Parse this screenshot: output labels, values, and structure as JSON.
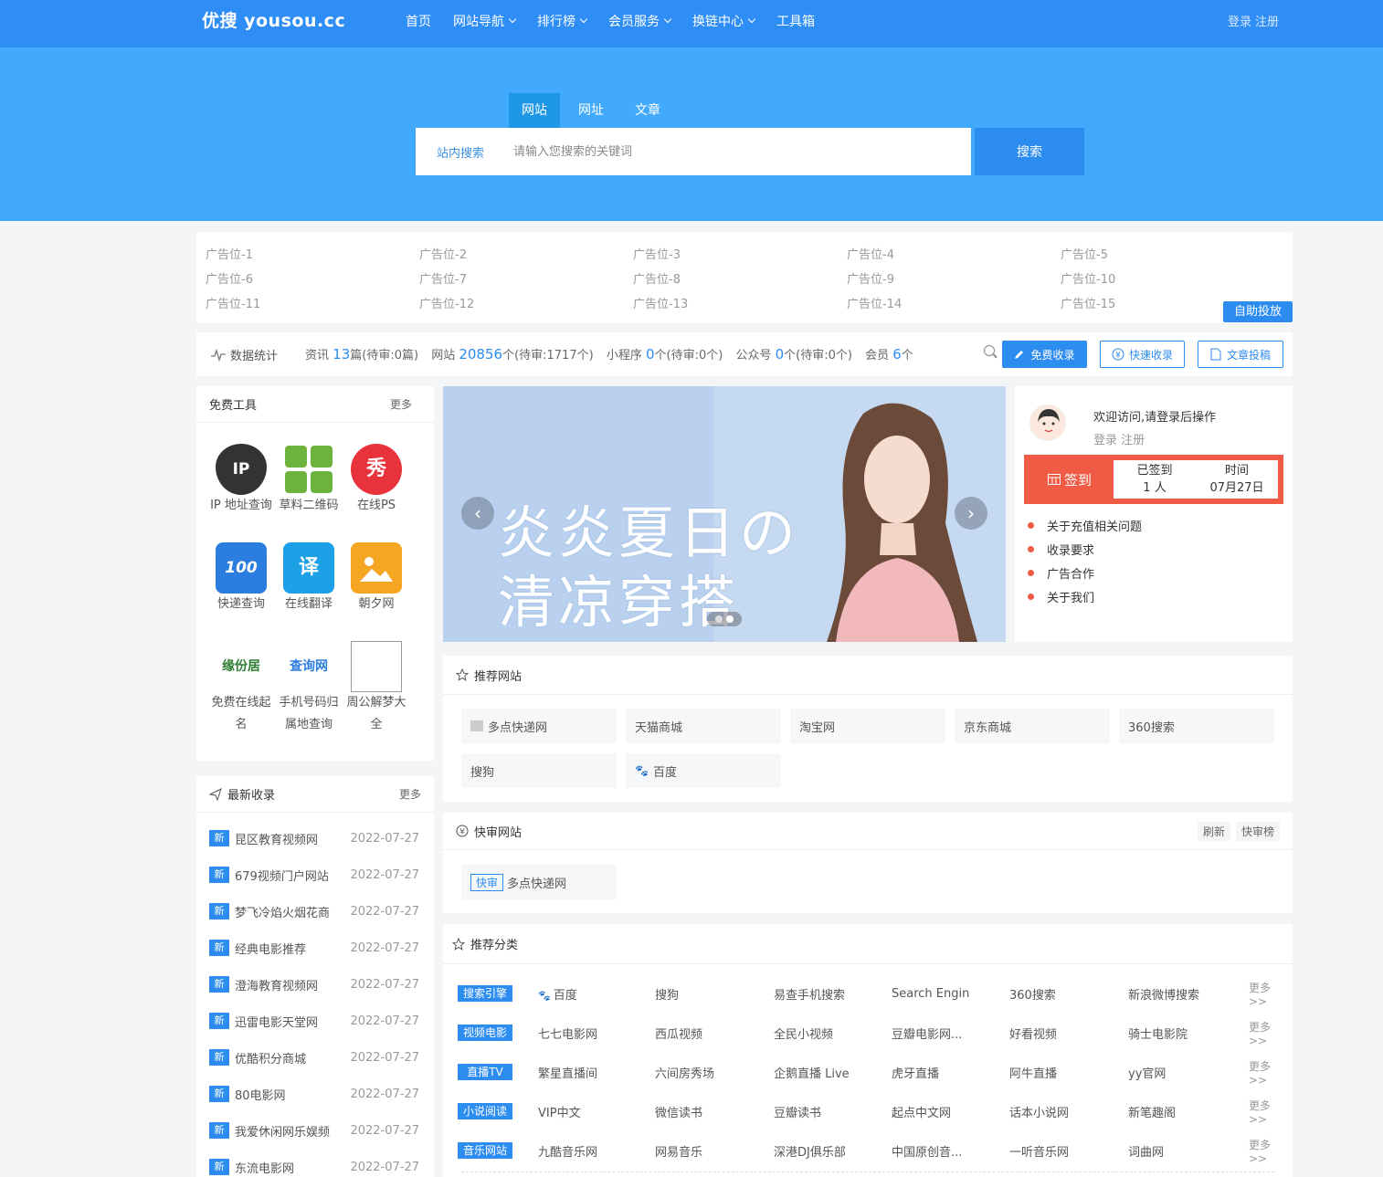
{
  "header": {
    "logo": "优搜 yousou.cc",
    "nav": [
      {
        "label": "首页",
        "dropdown": false
      },
      {
        "label": "网站导航",
        "dropdown": true
      },
      {
        "label": "排行榜",
        "dropdown": true
      },
      {
        "label": "会员服务",
        "dropdown": true
      },
      {
        "label": "换链中心",
        "dropdown": true
      },
      {
        "label": "工具箱",
        "dropdown": false
      }
    ],
    "login": "登录",
    "register": "注册"
  },
  "search": {
    "tabs": [
      "网站",
      "网址",
      "文章"
    ],
    "active_tab": "网站",
    "label": "站内搜索",
    "placeholder": "请输入您搜索的关键词",
    "button": "搜索"
  },
  "ads": {
    "slots": [
      "广告位-1",
      "广告位-2",
      "广告位-3",
      "广告位-4",
      "广告位-5",
      "广告位-6",
      "广告位-7",
      "广告位-8",
      "广告位-9",
      "广告位-10",
      "广告位-11",
      "广告位-12",
      "广告位-13",
      "广告位-14",
      "广告位-15"
    ],
    "button": "自助投放"
  },
  "stats": {
    "title": "数据统计",
    "items": [
      {
        "label": "资讯",
        "count": "13",
        "suffix": "篇(待审:0篇)"
      },
      {
        "label": "网站",
        "count": "20856",
        "suffix": "个(待审:1717个)"
      },
      {
        "label": "小程序",
        "count": "0",
        "suffix": "个(待审:0个)"
      },
      {
        "label": "公众号",
        "count": "0",
        "suffix": "个(待审:0个)"
      },
      {
        "label": "会员",
        "count": "6",
        "suffix": "个"
      }
    ],
    "buttons": {
      "free": "免费收录",
      "fast": "快速收录",
      "article": "文章投稿"
    }
  },
  "tools": {
    "title": "免费工具",
    "more": "更多",
    "items": [
      {
        "label": "IP 地址查询",
        "icon": "ip-icon",
        "glyph": "IP",
        "color": "#333333"
      },
      {
        "label": "草料二维码",
        "icon": "qrcode-icon",
        "glyph": "",
        "color": "#6cb33f"
      },
      {
        "label": "在线PS",
        "icon": "ps-icon",
        "glyph": "秀",
        "color": "#e8323c"
      },
      {
        "label": "快递查询",
        "icon": "express-icon",
        "glyph": "100",
        "color": "#2b7de0"
      },
      {
        "label": "在线翻译",
        "icon": "translate-icon",
        "glyph": "译",
        "color": "#1da1e6"
      },
      {
        "label": "朝夕网",
        "icon": "image-icon",
        "glyph": "",
        "color": "#f5a623"
      },
      {
        "label": "免费在线起名",
        "icon": "name-icon",
        "glyph": "缘份居",
        "color": "#ffffff"
      },
      {
        "label": "手机号码归属地查询",
        "icon": "phone-icon",
        "glyph": "查询网",
        "color": "#ffffff"
      },
      {
        "label": "周公解梦大全",
        "icon": "broken-image-icon",
        "glyph": "",
        "color": "#ffffff"
      }
    ]
  },
  "latest": {
    "title": "最新收录",
    "more": "更多",
    "tag": "新",
    "items": [
      {
        "title": "昆区教育视频网",
        "date": "2022-07-27"
      },
      {
        "title": "679视频门户网站",
        "date": "2022-07-27"
      },
      {
        "title": "梦飞冷焰火烟花商",
        "date": "2022-07-27"
      },
      {
        "title": "经典电影推荐",
        "date": "2022-07-27"
      },
      {
        "title": "澄海教育视频网",
        "date": "2022-07-27"
      },
      {
        "title": "迅雷电影天堂网",
        "date": "2022-07-27"
      },
      {
        "title": "优酷积分商城",
        "date": "2022-07-27"
      },
      {
        "title": "80电影网",
        "date": "2022-07-27"
      },
      {
        "title": "我爱休闲网乐娱频",
        "date": "2022-07-27"
      },
      {
        "title": "东流电影网",
        "date": "2022-07-27"
      }
    ]
  },
  "banner": {
    "line1": "炎炎夏日の",
    "line2": "清凉穿搭",
    "prev": "‹",
    "next": "›"
  },
  "user": {
    "welcome": "欢迎访问,请登录后操作",
    "login": "登录",
    "register": "注册",
    "sign_label": "签到",
    "signed_label": "已签到",
    "signed_count": "1 人",
    "time_label": "时间",
    "time_value": "07月27日",
    "links": [
      "关于充值相关问题",
      "收录要求",
      "广告合作",
      "关于我们"
    ]
  },
  "recommend": {
    "title": "推荐网站",
    "sites": [
      "多点快递网",
      "天猫商城",
      "淘宝网",
      "京东商城",
      "360搜索",
      "搜狗",
      "百度"
    ]
  },
  "quick": {
    "title": "快审网站",
    "refresh": "刷新",
    "rank": "快审榜",
    "tag": "快审",
    "site": "多点快递网"
  },
  "categories": {
    "title": "推荐分类",
    "more": "更多>>",
    "rows": [
      {
        "tag": "搜索引擎",
        "links": [
          "百度",
          "搜狗",
          "易查手机搜索",
          "Search Engin",
          "360搜索",
          "新浪微博搜索"
        ]
      },
      {
        "tag": "视频电影",
        "links": [
          "七七电影网",
          "西瓜视频",
          "全民小视频",
          "豆瓣电影网...",
          "好看视频",
          "骑士电影院"
        ]
      },
      {
        "tag": "直播TV",
        "links": [
          "繁星直播间",
          "六间房秀场",
          "企鹅直播 Live",
          "虎牙直播",
          "阿牛直播",
          "yy官网"
        ]
      },
      {
        "tag": "小说阅读",
        "links": [
          "VIP中文",
          "微信读书",
          "豆瓣读书",
          "起点中文网",
          "话本小说网",
          "新笔趣阁"
        ]
      },
      {
        "tag": "音乐网站",
        "links": [
          "九酷音乐网",
          "网易音乐",
          "深港DJ俱乐部",
          "中国原创音...",
          "一听音乐网",
          "词曲网"
        ]
      }
    ]
  }
}
